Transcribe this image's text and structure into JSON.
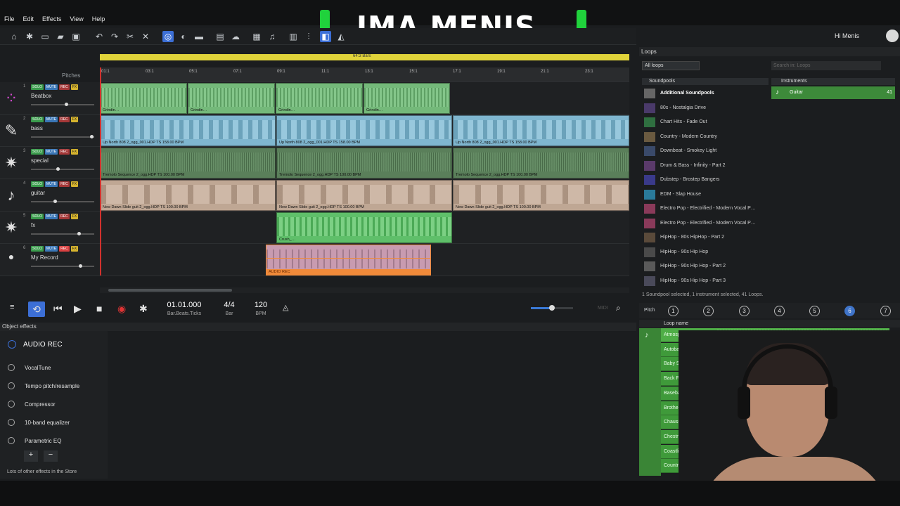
{
  "menu": [
    "File",
    "Edit",
    "Effects",
    "View",
    "Help"
  ],
  "brand": "IMA MENIS",
  "user": "Hi Menis",
  "arranger": {
    "pitches_label": "Pitches",
    "bars_label": "64:3 Bars",
    "ticks": [
      "01:1",
      "03:1",
      "05:1",
      "07:1",
      "09:1",
      "11:1",
      "13:1",
      "15:1",
      "17:1",
      "19:1",
      "21:1",
      "23:1"
    ],
    "tracks": [
      {
        "num": "1",
        "name": "Beatbox",
        "icon": "beatbox-icon",
        "glyph": "⁘"
      },
      {
        "num": "2",
        "name": "bass",
        "icon": "bass-guitar-icon",
        "glyph": "✎"
      },
      {
        "num": "3",
        "name": "special",
        "icon": "star-icon",
        "glyph": "✷"
      },
      {
        "num": "4",
        "name": "guitar",
        "icon": "guitar-icon",
        "glyph": "♪"
      },
      {
        "num": "5",
        "name": "fx",
        "icon": "fx-star-icon",
        "glyph": "✷"
      },
      {
        "num": "6",
        "name": "My Record",
        "icon": "rec-icon",
        "glyph": "●"
      }
    ],
    "buttons": {
      "solo": "SOLO",
      "mute": "MUTE",
      "rec": "REC",
      "fx": "FX"
    },
    "clip_labels": {
      "beatbox": "Grindin…",
      "bass": "Up North 808 2_ogg_001.HDP  TS  158.00 BPM",
      "special": "Tremolo Sequence 2_ogg.HDP  TS  100.00 BPM",
      "guitar": "New Dawn Slide guit 2_ogg.HDP  TS  100.00 BPM",
      "fx": "Crush_…",
      "rec": "AUDIO REC"
    }
  },
  "transport": {
    "position": "01.01.000",
    "position_unit": "Bar.Beats.Ticks",
    "signature": "4/4",
    "signature_unit": "Bar",
    "tempo": "120",
    "tempo_unit": "BPM",
    "midi": "MIDI"
  },
  "object_effects": {
    "title": "Object effects",
    "object": "AUDIO REC",
    "effects": [
      "VocalTune",
      "Tempo pitch/resample",
      "Compressor",
      "10-band equalizer",
      "Parametric EQ"
    ],
    "store_note": "Lots of other effects in the Store"
  },
  "loops": {
    "title": "Loops",
    "filter": "All loops",
    "search_placeholder": "Search in: Loops",
    "soundpools_header": "Soundpools",
    "instruments_header": "Instruments",
    "soundpools": [
      "Additional Soundpools",
      "80s - Nostalgia Drive",
      "Chart Hits - Fade Out",
      "Country - Modern Country",
      "Downbeat - Smokey Light",
      "Drum & Bass - Infinity - Part 2",
      "Dubstep - Brostep Bangers",
      "EDM - Slap House",
      "Electro Pop - Electrified - Modern Vocal P…",
      "Electro Pop - Electrified - Modern Vocal P…",
      "HipHop - 80s HipHop - Part 2",
      "HipHop - 90s Hip Hop",
      "HipHop - 90s Hip Hop - Part 2",
      "HipHop - 90s Hip Hop - Part 3"
    ],
    "instrument": {
      "name": "Guitar",
      "count": "41"
    },
    "status": "1 Soundpool selected, 1 instrument selected, 41 Loops.",
    "pitch_label": "Pitch",
    "pitches": [
      "1",
      "2",
      "3",
      "4",
      "5",
      "6",
      "7"
    ],
    "selected_pitch": "6",
    "loop_name_header": "Loop name",
    "loop_names": [
      "Atmosphere",
      "Autobahn",
      "Baby Steps",
      "Back For More",
      "Baseball",
      "Brother",
      "Chaussee",
      "Chestnut",
      "Coastline",
      "Countryside"
    ]
  },
  "colors": {
    "accent": "#3c6fd6",
    "clip_green": "#74b97a",
    "clip_blue": "#7fb6cf",
    "loop_green": "#3f9a3a",
    "brand_green": "#20d23c"
  }
}
